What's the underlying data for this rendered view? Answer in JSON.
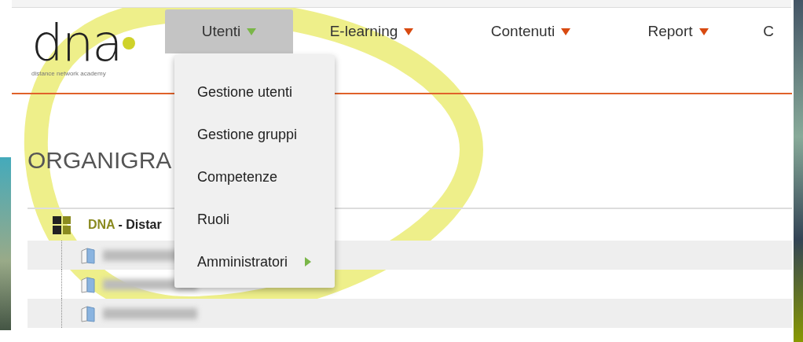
{
  "logo": {
    "wordmark": "dna",
    "tagline": "distance network academy"
  },
  "nav": [
    {
      "label": "Utenti",
      "selected": true,
      "caret": true
    },
    {
      "label": "E-learning",
      "selected": false,
      "caret": true
    },
    {
      "label": "Contenuti",
      "selected": false,
      "caret": true
    },
    {
      "label": "Report",
      "selected": false,
      "caret": true
    },
    {
      "label": "C",
      "selected": false,
      "caret": false
    }
  ],
  "dropdown": [
    {
      "label": "Gestione utenti",
      "has_submenu": false
    },
    {
      "label": "Gestione gruppi",
      "has_submenu": false
    },
    {
      "label": "Competenze",
      "has_submenu": false
    },
    {
      "label": "Ruoli",
      "has_submenu": false
    },
    {
      "label": "Amministratori",
      "has_submenu": true
    }
  ],
  "page_title": "ORGANIGRA",
  "tree": {
    "root": {
      "code": "DNA",
      "rest": "- Distar"
    },
    "children": [
      {
        "kind": "folder"
      },
      {
        "kind": "folder"
      },
      {
        "kind": "folder"
      }
    ]
  }
}
